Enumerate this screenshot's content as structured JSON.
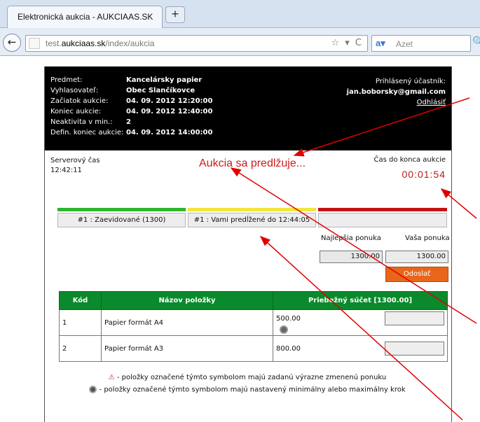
{
  "browser": {
    "tab_title": "Elektronická aukcia - AUKCIAAS.SK",
    "new_tab": "+",
    "url_prefix": "test.",
    "url_domain": "aukciaas.sk",
    "url_path": "/index/aukcia",
    "search_engine_logo": "a",
    "search_placeholder": "Azet"
  },
  "auction_info": {
    "rows": [
      {
        "label": "Predmet:",
        "value": "Kancelársky papier"
      },
      {
        "label": "Vyhlasovateľ:",
        "value": "Obec Slančíkovce"
      },
      {
        "label": "Začiatok aukcie:",
        "value": "04. 09. 2012 12:20:00"
      },
      {
        "label": "Koniec aukcie:",
        "value": "04. 09. 2012 12:40:00"
      },
      {
        "label": "Neaktivita v min.:",
        "value": "2"
      },
      {
        "label": "Defin. koniec aukcie:",
        "value": "04. 09. 2012 14:00:00"
      }
    ],
    "participant_label": "Prihlásený účastník:",
    "participant_email": "jan.boborsky@gmail.com",
    "logout": "Odhlásiť"
  },
  "status": {
    "server_time_label": "Serverový čas",
    "server_time": "12:42:11",
    "extend_message": "Aukcia sa predlžuje...",
    "remaining_label": "Čas do konca aukcie",
    "remaining_time": "00:01:54"
  },
  "status_bars": [
    {
      "label": "#1 : Zaevidované (1300)",
      "color": "#2fb52f"
    },
    {
      "label": "#1 : Vami predĺžené do 12:44:05",
      "color": "#f0e63c"
    },
    {
      "label": "",
      "color": "#c41212"
    }
  ],
  "offers": {
    "best_label": "Najlepšia ponuka",
    "yours_label": "Vaša ponuka",
    "best_value": "1300.00",
    "your_value": "1300.00",
    "send_label": "Odoslať"
  },
  "table": {
    "headers": [
      "Kód",
      "Názov položky",
      "Priebežný súčet [1300.00]"
    ],
    "rows": [
      {
        "code": "1",
        "name": "Papier formát A4",
        "sum": "500.00"
      },
      {
        "code": "2",
        "name": "Papier formát A3",
        "sum": "800.00"
      }
    ]
  },
  "legend": {
    "warn_symbol": "⚠",
    "warn_text": " - položky označené týmto symbolom majú zadanú výrazne zmenenú ponuku",
    "step_text": " - položky označené týmto symbolom majú nastavený minimálny alebo maximálny krok"
  },
  "colors": {
    "header_bg": "#000000",
    "accent_red": "#d01919",
    "table_header": "#0a8a2c",
    "send_button": "#e8661b",
    "arrow": "#e00000"
  }
}
